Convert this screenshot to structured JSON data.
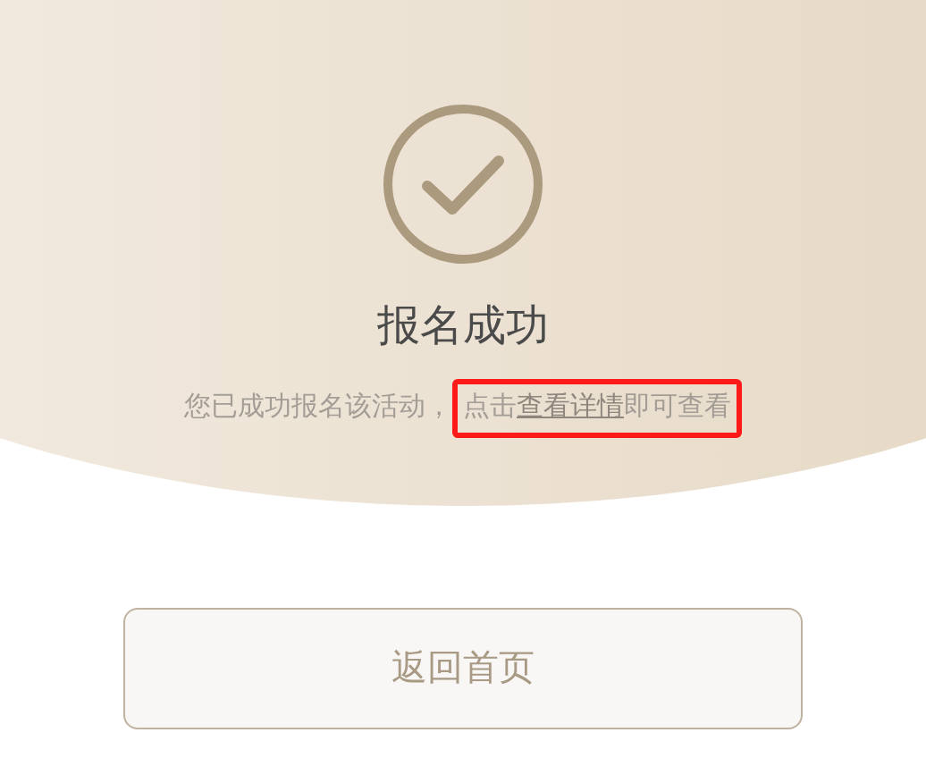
{
  "status": {
    "title": "报名成功",
    "message": "您已成功报名该活动，",
    "hint": {
      "before": "点击",
      "link": "查看详情",
      "after": "即可查看",
      "highlighted": true
    }
  },
  "button": {
    "label": "返回首页"
  }
}
